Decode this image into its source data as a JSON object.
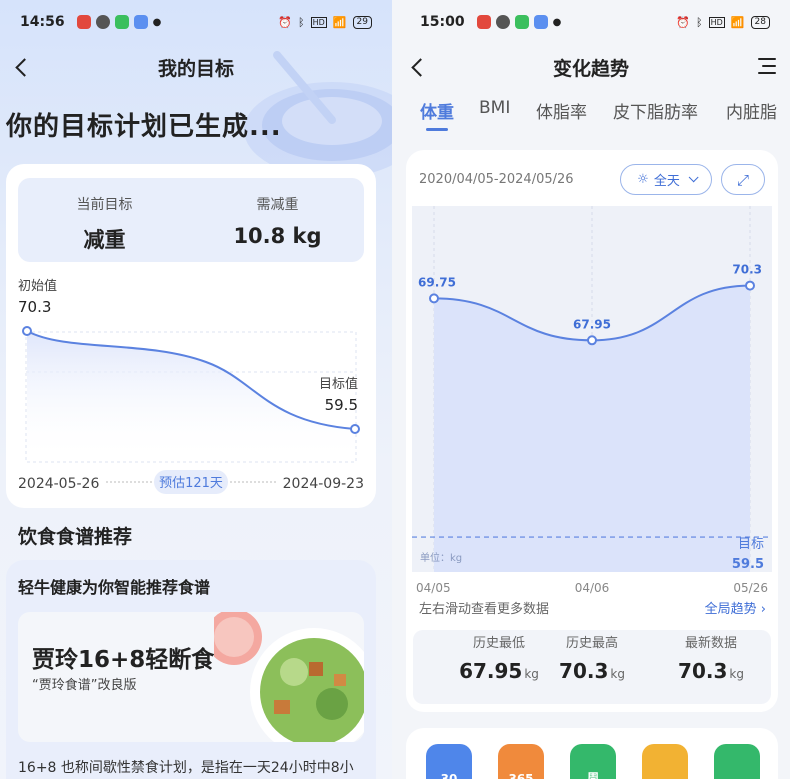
{
  "left": {
    "status": {
      "time": "14:56",
      "battery": "29"
    },
    "nav_title": "我的目标",
    "headline": "你的目标计划已生成...",
    "goal": {
      "current_label": "当前目标",
      "current_value": "减重",
      "need_label": "需减重",
      "need_value": "10.8 kg"
    },
    "chart": {
      "start_label": "初始值",
      "start_value": "70.3",
      "target_label": "目标值",
      "target_value": "59.5",
      "start_date": "2024-05-26",
      "estimate": "预估121天",
      "end_date": "2024-09-23"
    },
    "diet_section": "饮食食谱推荐",
    "recipe": {
      "intro": "轻牛健康为你智能推荐食谱",
      "title": "贾玲16+8轻断食",
      "subtitle": "“贾玲食谱”改良版",
      "desc": "16+8 也称间歇性禁食计划，是指在一天24小时中8小"
    }
  },
  "right": {
    "status": {
      "time": "15:00",
      "battery": "28"
    },
    "nav_title": "变化趋势",
    "tabs": [
      "体重",
      "BMI",
      "体脂率",
      "皮下脂肪率",
      "内脏脂"
    ],
    "date_range": "2020/04/05-2024/05/26",
    "filter": "全天",
    "hint": "左右滑动查看更多数据",
    "global_trend": "全局趋势",
    "unit_label": "单位：kg",
    "target_label": "目标",
    "target_value": "59.5",
    "stats": [
      {
        "label": "历史最低",
        "value": "67.95",
        "unit": "kg"
      },
      {
        "label": "历史最高",
        "value": "70.3",
        "unit": "kg"
      },
      {
        "label": "最新数据",
        "value": "70.3",
        "unit": "kg"
      }
    ],
    "bottom_icons": [
      {
        "text": "30",
        "color": "#4f86ea"
      },
      {
        "text": "365",
        "color": "#f08a3c"
      },
      {
        "text": "周",
        "color": "#34b86b"
      },
      {
        "text": "",
        "color": "#f2b233"
      },
      {
        "text": "",
        "color": "#34b86b"
      }
    ]
  },
  "chart_data": [
    {
      "type": "area",
      "title": "",
      "x": [
        "2024-05-26",
        "2024-09-23"
      ],
      "values": [
        70.3,
        59.5
      ],
      "labels": [
        "初始值",
        "目标值"
      ]
    },
    {
      "type": "area",
      "title": "",
      "x": [
        "04/05",
        "04/06",
        "05/26"
      ],
      "series": [
        {
          "values": [
            69.75,
            67.95,
            70.3
          ]
        }
      ],
      "target": 59.5,
      "ylabel": "单位：kg"
    }
  ],
  "colors": {
    "accent": "#4f7bdc",
    "line": "#5b82e0",
    "fill": "#dfe6fb"
  }
}
